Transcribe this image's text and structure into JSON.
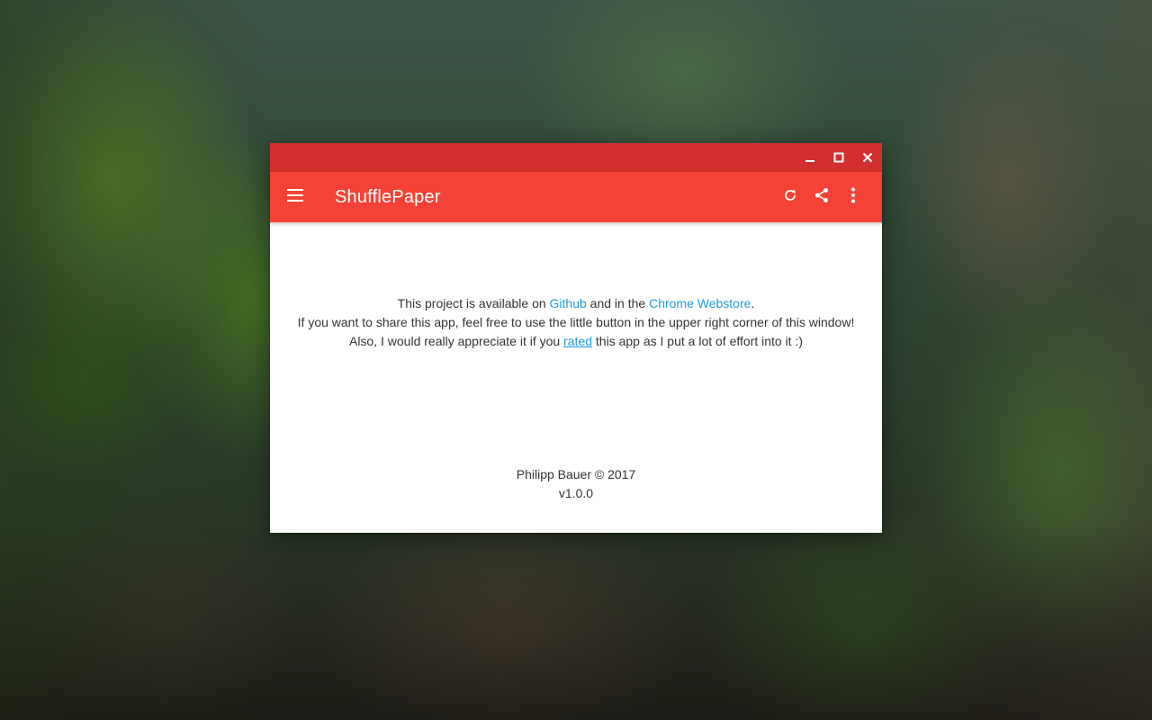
{
  "window": {
    "minimize_icon": "minimize-icon",
    "maximize_icon": "maximize-icon",
    "close_icon": "close-icon",
    "title_bar_color": "#d32f2f"
  },
  "app_bar": {
    "title": "ShufflePaper",
    "color": "#f44336",
    "menu_icon": "hamburger-menu-icon",
    "actions": [
      "refresh-icon",
      "share-icon",
      "more-vert-icon"
    ]
  },
  "content": {
    "line1": {
      "prefix": "This project is available on ",
      "github_link": "Github",
      "middle": " and in the ",
      "webstore_link": "Chrome Webstore",
      "suffix": "."
    },
    "line2": "If you want to share this app, feel free to use the little button in the upper right corner of this window!",
    "line3": {
      "prefix": "Also, I would really appreciate it if you ",
      "rated_link": "rated",
      "suffix": " this app as I put a lot of effort into it :)"
    },
    "link_color": "#1e9be0"
  },
  "footer": {
    "author": "Philipp Bauer © 2017",
    "version": "v1.0.0"
  }
}
